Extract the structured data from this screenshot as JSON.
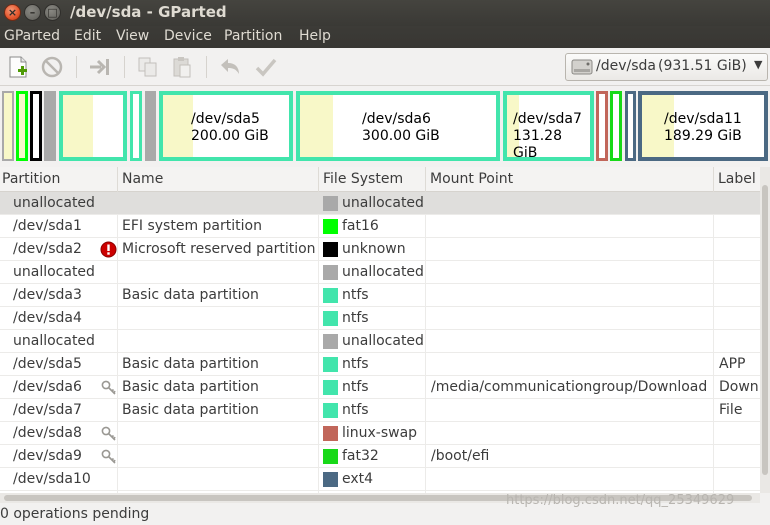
{
  "window": {
    "title": "/dev/sda - GParted"
  },
  "menu": [
    "GParted",
    "Edit",
    "View",
    "Device",
    "Partition",
    "Help"
  ],
  "toolbar": {
    "icons": [
      "new-partition",
      "delete",
      "resize-move",
      "copy",
      "paste",
      "undo",
      "apply"
    ]
  },
  "device_selector": {
    "device": "/dev/sda",
    "size": "(931.51 GiB)"
  },
  "disk_map": [
    {
      "label": "/dev/sda5",
      "size": "200.00 GiB",
      "used_fraction": 0.24
    },
    {
      "label": "/dev/sda6",
      "size": "300.00 GiB",
      "used_fraction": 0.17
    },
    {
      "label": "/dev/sda7",
      "size": "131.28 GiB",
      "used_fraction": 0.15
    },
    {
      "label": "/dev/sda11",
      "size": "189.29 GiB",
      "used_fraction": 0.26
    }
  ],
  "table": {
    "columns": [
      "Partition",
      "Name",
      "File System",
      "Mount Point",
      "Label"
    ],
    "rows": [
      {
        "partition": "unallocated",
        "name": "",
        "fs": "unallocated",
        "fs_color": "#a9a9a9",
        "mount": "",
        "label": "",
        "icon": ""
      },
      {
        "partition": "/dev/sda1",
        "name": "EFI system partition",
        "fs": "fat16",
        "fs_color": "#00ff00",
        "mount": "",
        "label": "",
        "icon": ""
      },
      {
        "partition": "/dev/sda2",
        "name": "Microsoft reserved partition",
        "fs": "unknown",
        "fs_color": "#000000",
        "mount": "",
        "label": "",
        "icon": "warning"
      },
      {
        "partition": "unallocated",
        "name": "",
        "fs": "unallocated",
        "fs_color": "#a9a9a9",
        "mount": "",
        "label": "",
        "icon": ""
      },
      {
        "partition": "/dev/sda3",
        "name": "Basic data partition",
        "fs": "ntfs",
        "fs_color": "#42e5ac",
        "mount": "",
        "label": "",
        "icon": ""
      },
      {
        "partition": "/dev/sda4",
        "name": "",
        "fs": "ntfs",
        "fs_color": "#42e5ac",
        "mount": "",
        "label": "",
        "icon": ""
      },
      {
        "partition": "unallocated",
        "name": "",
        "fs": "unallocated",
        "fs_color": "#a9a9a9",
        "mount": "",
        "label": "",
        "icon": ""
      },
      {
        "partition": "/dev/sda5",
        "name": "Basic data partition",
        "fs": "ntfs",
        "fs_color": "#42e5ac",
        "mount": "",
        "label": "APP",
        "icon": ""
      },
      {
        "partition": "/dev/sda6",
        "name": "Basic data partition",
        "fs": "ntfs",
        "fs_color": "#42e5ac",
        "mount": "/media/communicationgroup/Download",
        "label": "Down",
        "icon": "key"
      },
      {
        "partition": "/dev/sda7",
        "name": "Basic data partition",
        "fs": "ntfs",
        "fs_color": "#42e5ac",
        "mount": "",
        "label": "File",
        "icon": ""
      },
      {
        "partition": "/dev/sda8",
        "name": "",
        "fs": "linux-swap",
        "fs_color": "#c1665a",
        "mount": "",
        "label": "",
        "icon": "key"
      },
      {
        "partition": "/dev/sda9",
        "name": "",
        "fs": "fat32",
        "fs_color": "#18d918",
        "mount": "/boot/efi",
        "label": "",
        "icon": "key"
      },
      {
        "partition": "/dev/sda10",
        "name": "",
        "fs": "ext4",
        "fs_color": "#4b6983",
        "mount": "",
        "label": "",
        "icon": ""
      }
    ]
  },
  "status": {
    "text": "0 operations pending"
  },
  "watermark": "https://blog.csdn.net/qq_25349629"
}
